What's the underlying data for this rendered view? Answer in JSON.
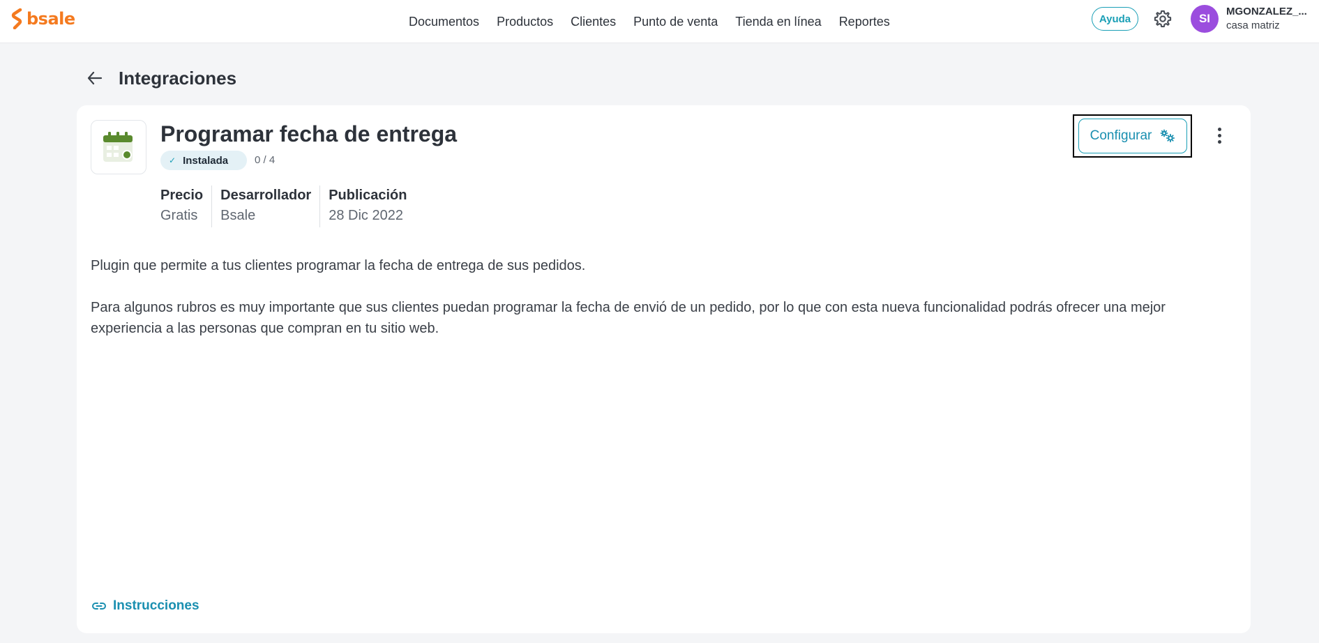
{
  "brand": {
    "logo_text": "bsale",
    "accent": "#f47a1f"
  },
  "nav": {
    "items": [
      {
        "label": "Documentos"
      },
      {
        "label": "Productos"
      },
      {
        "label": "Clientes"
      },
      {
        "label": "Punto de venta"
      },
      {
        "label": "Tienda en línea"
      },
      {
        "label": "Reportes"
      }
    ]
  },
  "header_right": {
    "help_label": "Ayuda",
    "settings_icon": "gear-icon",
    "avatar_initials": "SI",
    "avatar_color": "#9b4dde",
    "user_name": "MGONZALEZ_...",
    "branch": "casa matriz"
  },
  "page": {
    "title": "Integraciones",
    "back_icon": "arrow-left-icon"
  },
  "app": {
    "icon": "calendar-icon",
    "title": "Programar fecha de entrega",
    "status_label": "Instalada",
    "status_icon": "check-icon",
    "count": "0 / 4",
    "meta": [
      {
        "label": "Precio",
        "value": "Gratis"
      },
      {
        "label": "Desarrollador",
        "value": "Bsale"
      },
      {
        "label": "Publicación",
        "value": "28 Dic 2022"
      }
    ],
    "description": [
      "Plugin que permite a tus clientes programar la fecha de entrega de sus pedidos.",
      "Para algunos rubros es muy importante que sus clientes puedan programar la fecha de envió de un pedido, por lo que con esta nueva funcionalidad podrás ofrecer una mejor experiencia a las personas que compran en tu sitio web."
    ],
    "configure_label": "Configurar",
    "configure_icon": "gears-icon",
    "more_icon": "more-vertical-icon",
    "instructions_label": "Instrucciones",
    "instructions_icon": "link-icon"
  },
  "colors": {
    "primary": "#1a9fb6",
    "background": "#f4f5f7",
    "badge_bg": "#e4f1f6"
  }
}
